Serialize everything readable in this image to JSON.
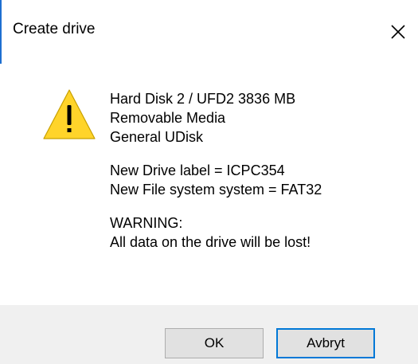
{
  "window": {
    "title": "Create drive",
    "close_icon": "close-icon"
  },
  "message": {
    "icon": "warning-icon",
    "drive_name": "Hard Disk 2 / UFD2 3836 MB",
    "media_type": "Removable Media",
    "device_name": "General UDisk",
    "new_label": "New Drive label = ICPC354",
    "new_fs": "New File system system  = FAT32",
    "warning_title": "WARNING:",
    "warning_text": "All data on the drive will be lost!"
  },
  "buttons": {
    "ok_label": "OK",
    "cancel_label": "Avbryt"
  },
  "colors": {
    "warning_yellow": "#ffd42a",
    "focus_border": "#0078d7",
    "button_bar": "#f0f0f0"
  }
}
